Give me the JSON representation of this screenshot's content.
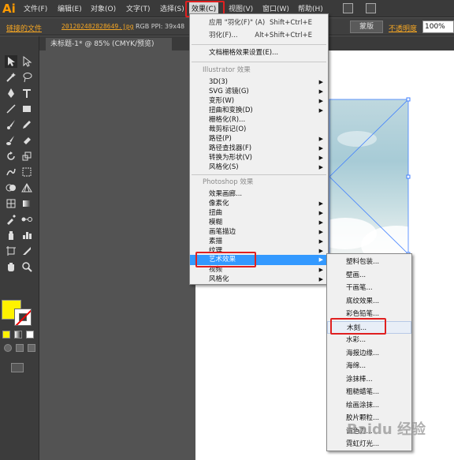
{
  "app": {
    "logo": "Ai"
  },
  "menubar": {
    "items": [
      {
        "label": "文件(F)"
      },
      {
        "label": "编辑(E)"
      },
      {
        "label": "对象(O)"
      },
      {
        "label": "文字(T)"
      },
      {
        "label": "选择(S)"
      },
      {
        "label": "效果(C)"
      },
      {
        "label": "视图(V)"
      },
      {
        "label": "窗口(W)"
      },
      {
        "label": "帮助(H)"
      }
    ]
  },
  "controlbar": {
    "linked_file": "链接的文件",
    "file_name": "20120248282",
    "file_name_rest": "8649.jpg",
    "file_info": "RGB  PPI: 39x48",
    "mask_button": "蒙版",
    "opacity_label": "不透明度",
    "opacity_value": "100%"
  },
  "document": {
    "tab_title": "未标题-1* @ 85% (CMYK/预览)"
  },
  "effect_menu": {
    "apply_last": "应用 \"羽化(F)\" (A)",
    "apply_last_shortcut": "Shift+Ctrl+E",
    "last_effect": "羽化(F)...",
    "last_effect_shortcut": "Alt+Shift+Ctrl+E",
    "raster_settings": "文档栅格效果设置(E)...",
    "illustrator_header": "Illustrator 效果",
    "illustrator_items": [
      {
        "label": "3D(3)",
        "sub": true
      },
      {
        "label": "SVG 滤镜(G)",
        "sub": true
      },
      {
        "label": "变形(W)",
        "sub": true
      },
      {
        "label": "扭曲和变换(D)",
        "sub": true
      },
      {
        "label": "栅格化(R)...",
        "sub": false
      },
      {
        "label": "裁剪标记(O)",
        "sub": false
      },
      {
        "label": "路径(P)",
        "sub": true
      },
      {
        "label": "路径查找器(F)",
        "sub": true
      },
      {
        "label": "转换为形状(V)",
        "sub": true
      },
      {
        "label": "风格化(S)",
        "sub": true
      }
    ],
    "photoshop_header": "Photoshop 效果",
    "photoshop_items": [
      {
        "label": "效果画廊...",
        "sub": false
      },
      {
        "label": "像素化",
        "sub": true
      },
      {
        "label": "扭曲",
        "sub": true
      },
      {
        "label": "模糊",
        "sub": true
      },
      {
        "label": "画笔描边",
        "sub": true
      },
      {
        "label": "素描",
        "sub": true
      },
      {
        "label": "纹理",
        "sub": true
      },
      {
        "label": "艺术效果",
        "sub": true
      },
      {
        "label": "视频",
        "sub": true
      },
      {
        "label": "风格化",
        "sub": true
      }
    ]
  },
  "artistic_submenu": {
    "items": [
      {
        "label": "塑料包装..."
      },
      {
        "label": "壁画..."
      },
      {
        "label": "干画笔..."
      },
      {
        "label": "底纹效果..."
      },
      {
        "label": "彩色铅笔..."
      },
      {
        "label": "木刻..."
      },
      {
        "label": "水彩..."
      },
      {
        "label": "海报边缘..."
      },
      {
        "label": "海绵..."
      },
      {
        "label": "涂抹棒..."
      },
      {
        "label": "粗糙蜡笔..."
      },
      {
        "label": "绘画涂抹..."
      },
      {
        "label": "胶片颗粒..."
      },
      {
        "label": "调色刀..."
      },
      {
        "label": "霓虹灯光..."
      }
    ]
  },
  "watermark": "Baidu 经验",
  "colors": {
    "fill": "#fff200",
    "menu_highlight": "#3399ff",
    "annotation": "#e02020"
  }
}
